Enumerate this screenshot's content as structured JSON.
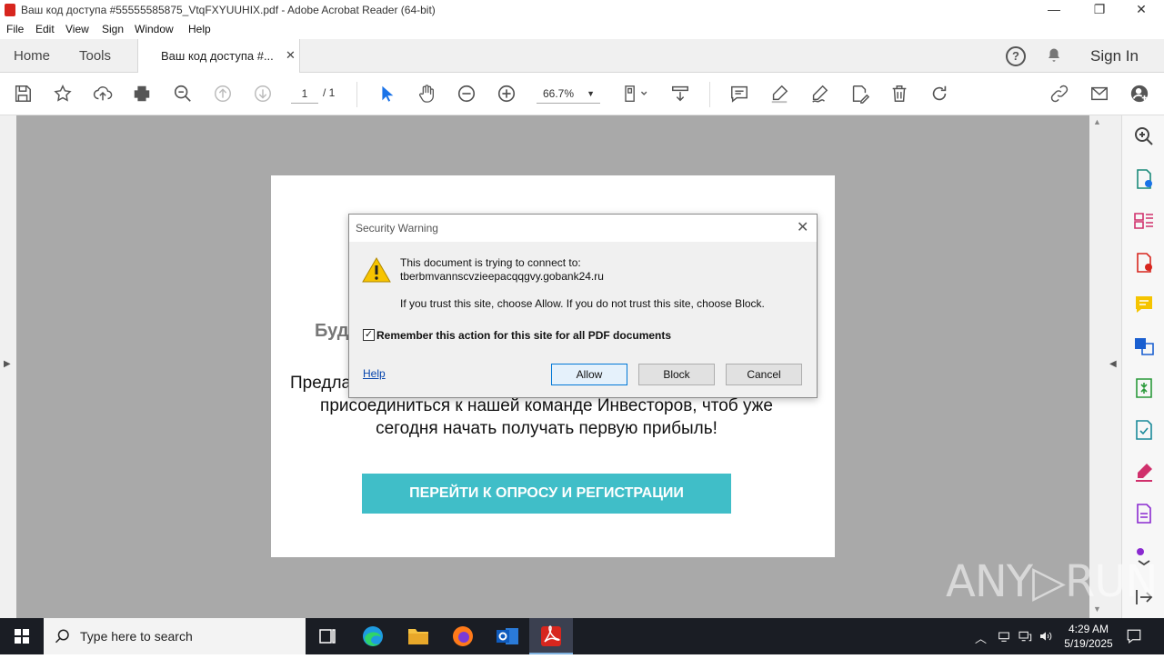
{
  "window": {
    "title": "Ваш код доступа #55555585875_VtqFXYUUHIX.pdf - Adobe Acrobat Reader (64-bit)",
    "controls": {
      "minimize": "—",
      "restore": "❐",
      "close": "✕"
    }
  },
  "menu": [
    "File",
    "Edit",
    "View",
    "Sign",
    "Window",
    "Help"
  ],
  "tabs": {
    "home": "Home",
    "tools": "Tools",
    "document": "Ваш код доступа #...",
    "close": "✕",
    "sign_in": "Sign In",
    "help": "?"
  },
  "toolbar": {
    "page_current": "1",
    "page_total": "/ 1",
    "zoom": "66.7%",
    "icons": [
      "save-icon",
      "star-icon",
      "upload-icon",
      "print-icon",
      "zoom-search-icon",
      "prev-page-icon",
      "next-page-icon",
      "select-cursor-icon",
      "hand-icon",
      "zoom-out-icon",
      "zoom-in-icon",
      "page-fit-icon",
      "scroll-mode-icon",
      "comment-icon",
      "highlight-icon",
      "sign-icon",
      "edit-icon",
      "delete-icon",
      "rotate-icon",
      "link-icon",
      "mail-icon",
      "user-add-icon"
    ]
  },
  "pdf": {
    "heading_fragment": "Буд",
    "line1_fragment": "Предла",
    "line2": "присоединиться к нашей команде Инвесторов, чтоб уже",
    "line3": "сегодня начать получать первую прибыль!",
    "cta": "ПЕРЕЙТИ К ОПРОСУ И РЕГИСТРАЦИИ"
  },
  "dialog": {
    "title": "Security Warning",
    "message": "This document is trying to connect to:",
    "host": "tberbmvannscvzieepacqqgvy.gobank24.ru",
    "advice": "If you trust this site, choose Allow. If you do not trust this site, choose Block.",
    "remember_label": "Remember this action for this site for all PDF documents",
    "remember_checked": true,
    "check_mark": "✓",
    "help": "Help",
    "allow": "Allow",
    "block": "Block",
    "cancel": "Cancel"
  },
  "watermark": "ANY▷RUN",
  "taskbar": {
    "search_placeholder": "Type here to search",
    "time": "4:29 AM",
    "date": "5/19/2025"
  },
  "colors": {
    "accent_red": "#d7261e",
    "cta_teal": "#40bec8",
    "doc_bg": "#a9a9a9",
    "select_blue": "#1a73e8"
  }
}
